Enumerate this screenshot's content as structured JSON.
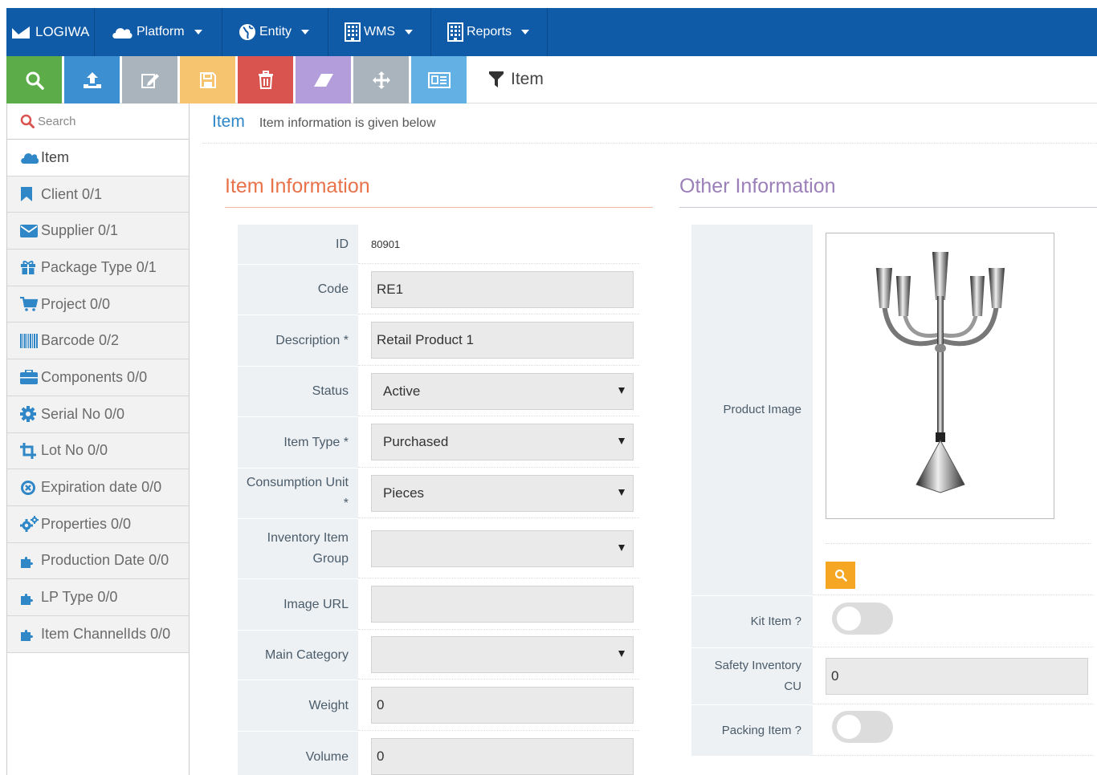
{
  "topnav": {
    "brand": "LOGIWA",
    "menus": [
      {
        "label": "Platform",
        "icon": "cloud-icon"
      },
      {
        "label": "Entity",
        "icon": "globe-icon"
      },
      {
        "label": "WMS",
        "icon": "building-icon"
      },
      {
        "label": "Reports",
        "icon": "building-icon"
      }
    ]
  },
  "toolbar": {
    "buttons": [
      {
        "name": "search-button",
        "icon": "search-icon",
        "color": "#5cad4a"
      },
      {
        "name": "upload-button",
        "icon": "upload-icon",
        "color": "#3c8fd0"
      },
      {
        "name": "edit-button",
        "icon": "edit-icon",
        "color": "#a9b4bd"
      },
      {
        "name": "save-button",
        "icon": "save-icon",
        "color": "#f6c46e"
      },
      {
        "name": "delete-button",
        "icon": "trash-icon",
        "color": "#d9534f"
      },
      {
        "name": "clear-button",
        "icon": "eraser-icon",
        "color": "#b39ddb"
      },
      {
        "name": "move-button",
        "icon": "move-icon",
        "color": "#a9b4bd"
      },
      {
        "name": "list-button",
        "icon": "list-icon",
        "color": "#63b0e4"
      }
    ],
    "title": "Item"
  },
  "sidebar": {
    "search_label": "Search",
    "items": [
      {
        "label": "Item",
        "icon": "cloud-icon",
        "active": true
      },
      {
        "label": "Client 0/1",
        "icon": "bookmark-icon"
      },
      {
        "label": "Supplier 0/1",
        "icon": "envelope-icon"
      },
      {
        "label": "Package Type 0/1",
        "icon": "gift-icon"
      },
      {
        "label": "Project 0/0",
        "icon": "cart-icon"
      },
      {
        "label": "Barcode 0/2",
        "icon": "barcode-icon"
      },
      {
        "label": "Components 0/0",
        "icon": "briefcase-icon"
      },
      {
        "label": "Serial No 0/0",
        "icon": "gear-icon"
      },
      {
        "label": "Lot No 0/0",
        "icon": "crop-icon"
      },
      {
        "label": "Expiration date 0/0",
        "icon": "close-circle-icon"
      },
      {
        "label": "Properties 0/0",
        "icon": "gears-icon"
      },
      {
        "label": "Production Date 0/0",
        "icon": "puzzle-icon"
      },
      {
        "label": "LP Type 0/0",
        "icon": "puzzle-icon"
      },
      {
        "label": "Item ChannelIds 0/0",
        "icon": "puzzle-icon"
      }
    ]
  },
  "header": {
    "title": "Item",
    "subtitle": "Item information is given below"
  },
  "item_info": {
    "title": "Item Information",
    "accent": "#e8724a",
    "fields": [
      {
        "label": "ID",
        "value": "80901",
        "type": "static"
      },
      {
        "label": "Code",
        "value": "RE1",
        "type": "input"
      },
      {
        "label": "Description *",
        "value": "Retail Product 1",
        "type": "input"
      },
      {
        "label": "Status",
        "value": "Active",
        "type": "select"
      },
      {
        "label": "Item Type *",
        "value": "Purchased",
        "type": "select"
      },
      {
        "label": "Consumption Unit *",
        "value": "Pieces",
        "type": "select"
      },
      {
        "label": "Inventory Item Group",
        "value": "",
        "type": "select"
      },
      {
        "label": "Image URL",
        "value": "",
        "type": "input"
      },
      {
        "label": "Main Category",
        "value": "",
        "type": "select"
      },
      {
        "label": "Weight",
        "value": "0",
        "type": "input"
      },
      {
        "label": "Volume",
        "value": "0",
        "type": "input"
      }
    ]
  },
  "other_info": {
    "title": "Other Information",
    "accent": "#9b7fb8",
    "product_image_label": "Product Image",
    "kit_item_label": "Kit Item ?",
    "safety_inventory_label": "Safety Inventory CU",
    "safety_inventory_value": "0",
    "packing_item_label": "Packing Item ?"
  }
}
